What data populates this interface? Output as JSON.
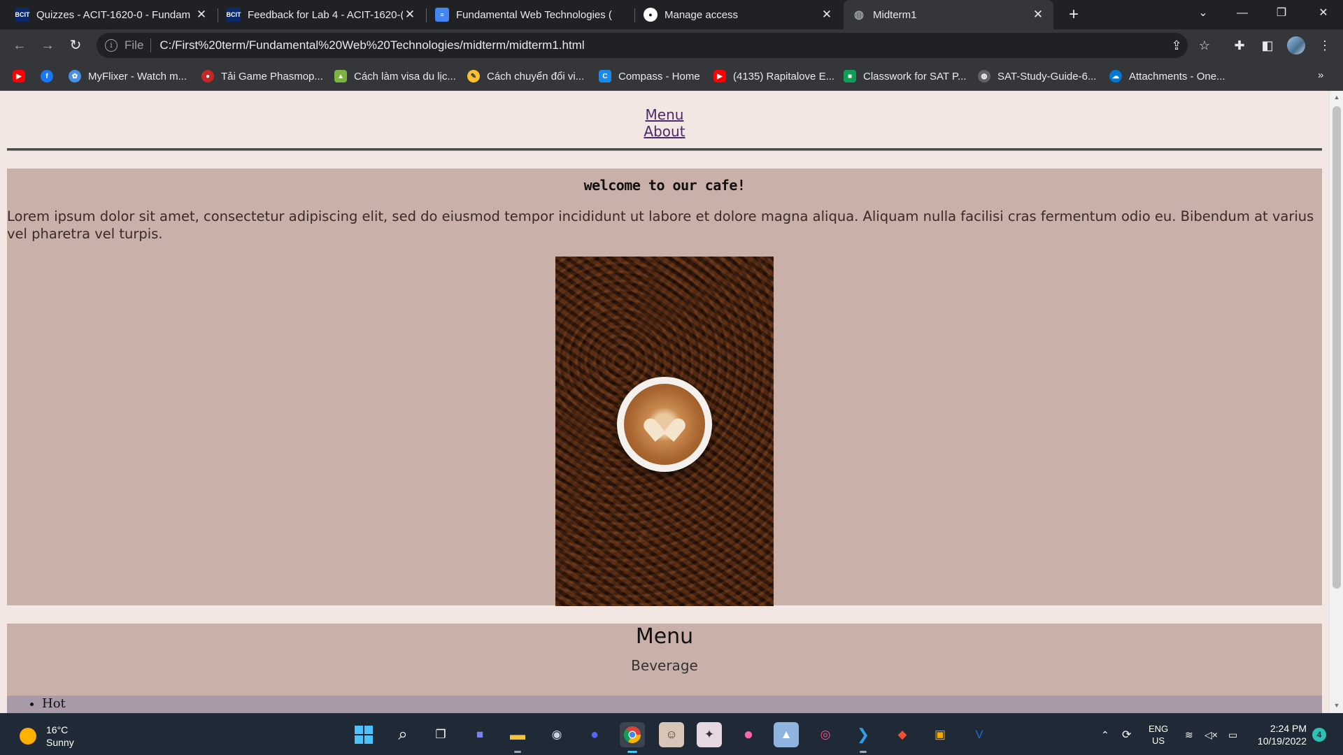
{
  "browser": {
    "tabs": [
      {
        "title": "Quizzes - ACIT-1620-0 - Fundam",
        "icon": "bcit-icon",
        "active": false
      },
      {
        "title": "Feedback for Lab 4 - ACIT-1620-(",
        "icon": "bcit-icon",
        "active": false
      },
      {
        "title": "Fundamental Web Technologies (",
        "icon": "google-docs-icon",
        "active": false
      },
      {
        "title": "Manage access",
        "icon": "github-icon",
        "active": false
      },
      {
        "title": "Midterm1",
        "icon": "globe-icon",
        "active": true
      }
    ],
    "favicon_bcit": "BCIT",
    "new_tab_glyph": "+",
    "tab_close_glyph": "✕",
    "address": {
      "scheme": "File",
      "url": "C:/First%20term/Fundamental%20Web%20Technologies/midterm/midterm1.html"
    },
    "bookmarks": [
      {
        "label": "",
        "icon": "youtube-icon",
        "color": "#ff0000"
      },
      {
        "label": "",
        "icon": "facebook-icon",
        "color": "#1877f2"
      },
      {
        "label": "MyFlixer - Watch m...",
        "icon": "myflixer-icon",
        "color": "#4a90e2"
      },
      {
        "label": "Tải Game Phasmop...",
        "icon": "phasmophobia-icon",
        "color": "#c62828"
      },
      {
        "label": "Cách làm visa du lịc...",
        "icon": "visa-icon",
        "color": "#7cb342"
      },
      {
        "label": "Cách chuyển đổi vi...",
        "icon": "convert-icon",
        "color": "#fbc02d"
      },
      {
        "label": "Compass - Home",
        "icon": "compass-icon",
        "color": "#1e88e5"
      },
      {
        "label": "(4135) Rapitalove E...",
        "icon": "youtube-icon",
        "color": "#ff0000"
      },
      {
        "label": "Classwork for SAT P...",
        "icon": "classroom-icon",
        "color": "#0f9d58"
      },
      {
        "label": "SAT-Study-Guide-6...",
        "icon": "globe-icon",
        "color": "#9aa0a6"
      },
      {
        "label": "Attachments - One...",
        "icon": "onedrive-icon",
        "color": "#0078d4"
      }
    ],
    "bookmarks_more": "»"
  },
  "page": {
    "nav": {
      "menu": "Menu",
      "about": "About"
    },
    "welcome": {
      "heading": "welcome to our cafe!",
      "text": "Lorem ipsum dolor sit amet, consectetur adipiscing elit, sed do eiusmod tempor incididunt ut labore et dolore magna aliqua. Aliquam nulla facilisi cras fermentum odio eu. Bibendum at varius vel pharetra vel turpis."
    },
    "menu": {
      "heading": "Menu",
      "subheading": "Beverage",
      "items": [
        "Hot"
      ]
    }
  },
  "taskbar": {
    "weather": {
      "temp": "16°C",
      "condition": "Sunny"
    },
    "apps": [
      "windows-start-icon",
      "search-icon",
      "task-view-icon",
      "teams-chat-icon",
      "file-explorer-icon",
      "steam-icon",
      "discord-icon",
      "chrome-icon",
      "game-icon",
      "anime-game-icon",
      "osu-icon",
      "photos-icon",
      "creative-cloud-icon",
      "vscode-icon",
      "git-icon",
      "virtualbox-icon",
      "vmware-icon"
    ],
    "language": {
      "lang": "ENG",
      "region": "US"
    },
    "clock": {
      "time": "2:24 PM",
      "date": "10/19/2022"
    },
    "notifications": "4"
  },
  "colors": {
    "page_bg": "#f3e7e4",
    "section_bg": "#c9b0a8",
    "link": "#4b2a66",
    "hot_bar": "#a89aa8"
  }
}
